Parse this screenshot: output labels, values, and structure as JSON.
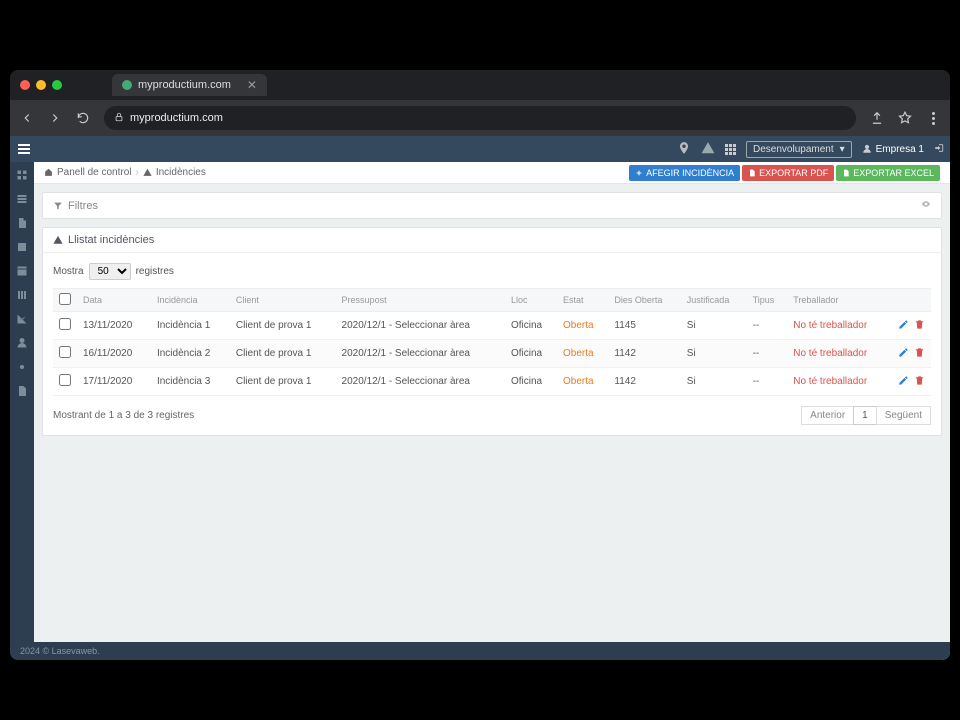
{
  "browser": {
    "tab_title": "myproductium.com",
    "url": "myproductium.com"
  },
  "topbar": {
    "dev_label": "Desenvolupament",
    "company": "Empresa 1"
  },
  "breadcrumb": {
    "home": "Panell de control",
    "current": "Incidències"
  },
  "actions": {
    "add": "AFEGIR INCIDÈNCIA",
    "pdf": "EXPORTAR PDF",
    "excel": "EXPORTAR EXCEL"
  },
  "filters": {
    "title": "Filtres"
  },
  "list": {
    "title": "Llistat incidències",
    "show": "Mostra",
    "per_page": "50",
    "records": "registres",
    "headers": {
      "data": "Data",
      "incidencia": "Incidència",
      "client": "Client",
      "pressupost": "Pressupost",
      "lloc": "Lloc",
      "estat": "Estat",
      "dies": "Dies Oberta",
      "justificada": "Justificada",
      "tipus": "Tipus",
      "treballador": "Treballador"
    },
    "rows": [
      {
        "data": "13/11/2020",
        "incidencia": "Incidència 1",
        "client": "Client de prova 1",
        "pressupost": "2020/12/1 - Seleccionar àrea",
        "lloc": "Oficina",
        "estat": "Oberta",
        "dies": "1145",
        "justificada": "Si",
        "tipus": "--",
        "treballador": "No té treballador"
      },
      {
        "data": "16/11/2020",
        "incidencia": "Incidència 2",
        "client": "Client de prova 1",
        "pressupost": "2020/12/1 - Seleccionar àrea",
        "lloc": "Oficina",
        "estat": "Oberta",
        "dies": "1142",
        "justificada": "Si",
        "tipus": "--",
        "treballador": "No té treballador"
      },
      {
        "data": "17/11/2020",
        "incidencia": "Incidència 3",
        "client": "Client de prova 1",
        "pressupost": "2020/12/1 - Seleccionar àrea",
        "lloc": "Oficina",
        "estat": "Oberta",
        "dies": "1142",
        "justificada": "Si",
        "tipus": "--",
        "treballador": "No té treballador"
      }
    ],
    "info": "Mostrant de 1 a 3 de 3 registres",
    "prev": "Anterior",
    "page": "1",
    "next": "Següent"
  },
  "footer": "2024 © Lasevaweb."
}
